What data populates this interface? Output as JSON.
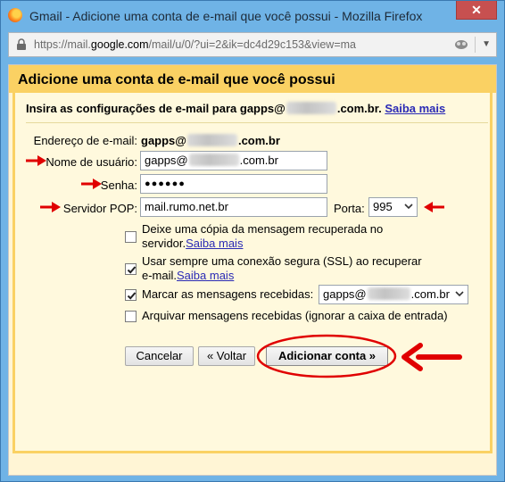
{
  "window": {
    "title": "Gmail - Adicione uma conta de e-mail que você possui - Mozilla Firefox",
    "close_label": "✕"
  },
  "urlbar": {
    "url_prefix": "https://mail.",
    "url_domain": "google.com",
    "url_path": "/mail/u/0/?ui=2&ik=dc4d29c153&view=ma"
  },
  "dialog": {
    "title": "Adicione uma conta de e-mail que você possui",
    "instruction_prefix": "Insira as configurações de e-mail para gapps@",
    "instruction_suffix": ".com.br.",
    "learn_more": "Saiba mais"
  },
  "form": {
    "email_label": "Endereço de e-mail:",
    "email_prefix": "gapps@",
    "email_suffix": ".com.br",
    "username_label": "Nome de usuário:",
    "username_prefix": "gapps@",
    "username_suffix": ".com.br",
    "password_label": "Senha:",
    "password_value": "●●●●●●",
    "pop_label": "Servidor POP:",
    "pop_value": "mail.rumo.net.br",
    "port_label": "Porta:",
    "port_value": "995"
  },
  "options": {
    "leave_copy_line1": "Deixe uma cópia da mensagem recuperada no",
    "leave_copy_line2": "servidor.",
    "leave_copy_link": "Saiba mais",
    "leave_copy_checked": false,
    "ssl_line1": "Usar sempre uma conexão segura (SSL) ao recuperar",
    "ssl_line2": "e-mail.",
    "ssl_link": "Saiba mais",
    "ssl_checked": true,
    "label_text": "Marcar as mensagens recebidas:",
    "label_select_prefix": "gapps@",
    "label_select_suffix": ".com.br",
    "label_checked": true,
    "archive_text": "Arquivar mensagens recebidas (ignorar a caixa de entrada)",
    "archive_checked": false
  },
  "buttons": {
    "cancel": "Cancelar",
    "back": "« Voltar",
    "add": "Adicionar conta »"
  },
  "colors": {
    "annotation_red": "#e00000",
    "header_yellow": "#fad163",
    "link_blue": "#2a2ab5"
  }
}
